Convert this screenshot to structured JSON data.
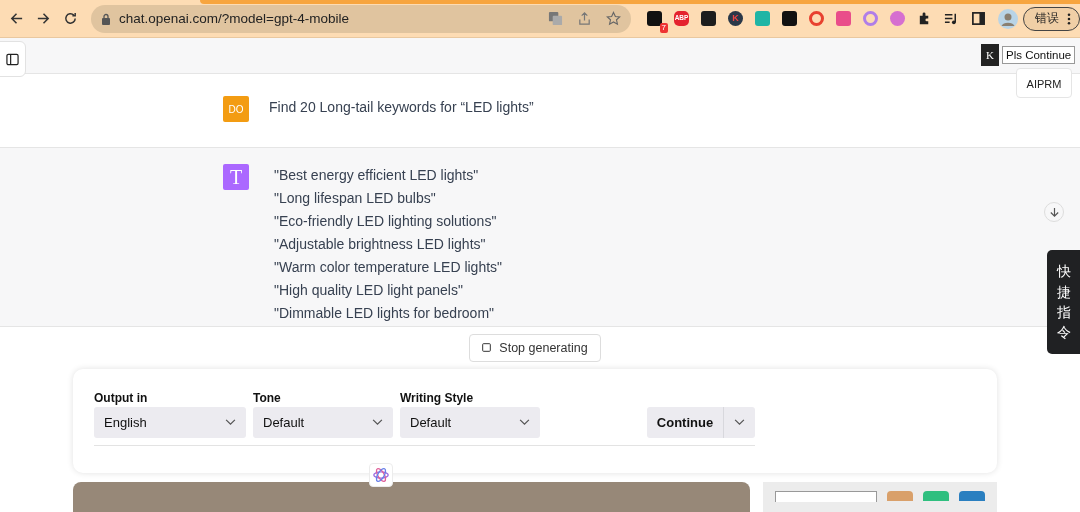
{
  "browser": {
    "url": "chat.openai.com/?model=gpt-4-mobile",
    "extensions": [
      {
        "kind": "square",
        "color": "#111111",
        "badge": "7"
      },
      {
        "kind": "octagon",
        "color": "#e4222e",
        "label": "ABP"
      },
      {
        "kind": "square",
        "color": "#1d1d1d"
      },
      {
        "kind": "circle",
        "color": "#2a3848",
        "label": "K"
      },
      {
        "kind": "square",
        "color": "#1fb5a5"
      },
      {
        "kind": "square",
        "color": "#111111"
      },
      {
        "kind": "ring",
        "color": "#e8412f"
      },
      {
        "kind": "square",
        "color": "#e94d8a"
      },
      {
        "kind": "ring",
        "color": "#b07ee8"
      },
      {
        "kind": "circle",
        "color": "#d66fd0"
      }
    ],
    "profile_button": "错误"
  },
  "messages": [
    {
      "kind": "prompt",
      "avatar": "DO",
      "lines": [
        "Find 20 Long-tail keywords for “LED lights”"
      ]
    },
    {
      "kind": "reply",
      "avatar": "T",
      "lines": [
        "\"Best energy efficient LED lights\"",
        "\"Long lifespan LED bulbs\"",
        "\"Eco-friendly LED lighting solutions\"",
        "\"Adjustable brightness LED lights\"",
        "\"Warm color temperature LED lights\"",
        "\"High quality LED light panels\"",
        "\"Dimmable LED lights for bedroom\""
      ]
    }
  ],
  "continue_chip": {
    "icon": "K",
    "label": "Pls Continue"
  },
  "aiprm_button": "AIPRM",
  "shortcut_tab": "快捷指令",
  "stop_button": "Stop generating",
  "prompt_panel": {
    "fields": [
      {
        "label": "Output in",
        "value": "English"
      },
      {
        "label": "Tone",
        "value": "Default"
      },
      {
        "label": "Writing Style",
        "value": "Default"
      }
    ],
    "continue_button": "Continue"
  }
}
